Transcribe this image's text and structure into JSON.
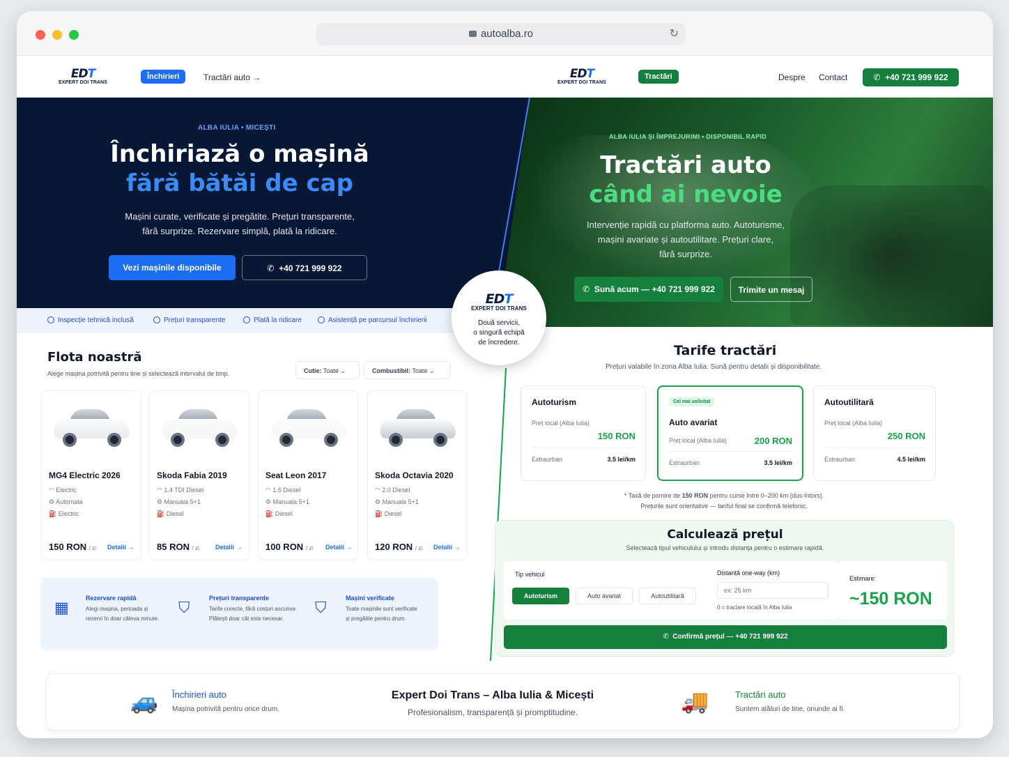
{
  "browser": {
    "url": "autoalba.ro"
  },
  "nav": {
    "logo_mark": "EDT",
    "logo_text": "EXPERT DOI TRANS",
    "rent_pill": "Închirieri",
    "tow_link": "Tractări auto",
    "tow_pill": "Tractări",
    "about": "Despre",
    "contact": "Contact",
    "phone": "+40 721 999 922"
  },
  "hero_left": {
    "kicker": "ALBA IULIA • MICEȘTI",
    "title_line1": "Închiriază o mașină",
    "title_line2": "fără bătăi de cap",
    "lead_line1": "Mașini curate, verificate și pregătite. Prețuri transparente,",
    "lead_line2": "fără surprize. Rezervare simplă, plată la ridicare.",
    "btn_primary": "Vezi mașinile disponibile",
    "btn_phone": "+40 721 999 922"
  },
  "hero_right": {
    "kicker": "ALBA IULIA ȘI ÎMPREJURIMI • DISPONIBIL RAPID",
    "title_line1": "Tractări auto",
    "title_line2": "când ai nevoie",
    "lead_line1": "Intervenție rapidă cu platforma auto. Autoturisme,",
    "lead_line2": "mașini avariate și autoutilitare. Prețuri clare,",
    "lead_line3": "fără surprize.",
    "btn_call": "Sună acum — +40 721 999 922",
    "btn_msg": "Trimite un mesaj"
  },
  "features": [
    "Inspecție tehnică inclusă",
    "Prețuri transparente",
    "Plată la ridicare",
    "Asistență pe parcursul închirierii"
  ],
  "badge": {
    "logo_mark": "EDT",
    "logo_text": "EXPERT DOI TRANS",
    "line1": "Două servicii,",
    "line2": "o singură echipă",
    "line3": "de încredere."
  },
  "fleet": {
    "title": "Flota noastră",
    "subtitle": "Alege mașina potrivită pentru tine și selectează intervalul de timp.",
    "filter_gear_label": "Cutie:",
    "filter_gear_value": "Toate",
    "filter_fuel_label": "Combustibil:",
    "filter_fuel_value": "Toate",
    "per_day": "/ zi",
    "details": "Detalii",
    "cars": [
      {
        "name": "MG4 Electric 2026",
        "engine": "Electric",
        "gearbox": "Automata",
        "fuel": "Electric",
        "price": "150 RON",
        "color": "#e8eaee"
      },
      {
        "name": "Skoda Fabia 2019",
        "engine": "1.4 TDI Diesel",
        "gearbox": "Manuala 5+1",
        "fuel": "Diesel",
        "price": "85 RON",
        "color": "#f5f5f5"
      },
      {
        "name": "Seat Leon 2017",
        "engine": "1.6 Diesel",
        "gearbox": "Manuala 5+1",
        "fuel": "Diesel",
        "price": "100 RON",
        "color": "#f8f8f8"
      },
      {
        "name": "Skoda Octavia 2020",
        "engine": "2.0 Diesel",
        "gearbox": "Manuala 5+1",
        "fuel": "Diesel",
        "price": "120 RON",
        "color": "#c8ccd2"
      }
    ]
  },
  "info": [
    {
      "title": "Rezervare rapidă",
      "d1": "Alegi mașina, perioada și",
      "d2": "rezervi în doar câteva minute."
    },
    {
      "title": "Prețuri transparente",
      "d1": "Tarife corecte, fără costuri ascunse.",
      "d2": "Plătești doar cât este necesar."
    },
    {
      "title": "Mașini verificate",
      "d1": "Toate mașinile sunt verificate",
      "d2": "și pregătite pentru drum."
    }
  ],
  "tariffs": {
    "title": "Tarife tractări",
    "subtitle": "Prețuri valabile în zona Alba Iulia. Sună pentru detalii și disponibilitate.",
    "local_label": "Preț local (Alba Iulia)",
    "extra_label": "Extraurban",
    "popular": "Cel mai solicitat",
    "cards": [
      {
        "name": "Autoturism",
        "price": "150 RON",
        "extra": "3.5 lei/km"
      },
      {
        "name": "Auto avariat",
        "price": "200 RON",
        "extra": "3.5 lei/km"
      },
      {
        "name": "Autoutilitară",
        "price": "250 RON",
        "extra": "4.5 lei/km"
      }
    ],
    "note1_pre": "* Taxă de pornire de ",
    "note1_bold": "150 RON",
    "note1_post": " pentru curse între 0–200 km (dus-întors).",
    "note2": "Prețurile sunt orientative — tariful final se confirmă telefonic."
  },
  "calc": {
    "title": "Calculează prețul",
    "subtitle": "Selectează tipul vehiculului și introdu distanța pentru o estimare rapidă.",
    "type_label": "Tip vehicul",
    "types": [
      "Autoturism",
      "Auto avariat",
      "Autoutilitară"
    ],
    "dist_label": "Distanță one-way (km)",
    "dist_placeholder": "ex: 25 km",
    "dist_hint": "0 = tractare locală în Alba Iulia",
    "est_label": "Estimare:",
    "est_value": "~150 RON",
    "confirm": "Confirmă prețul — +40 721 999 922"
  },
  "footer": {
    "rent_title": "Închirieri auto",
    "rent_desc": "Mașina potrivită pentru orice drum.",
    "brand_title": "Expert Doi Trans – Alba Iulia & Micești",
    "brand_desc": "Profesionalism, transparență și promptitudine.",
    "tow_title": "Tractări auto",
    "tow_desc": "Suntem alături de tine, oriunde ai fi."
  },
  "colors": {
    "navy": "#081736",
    "blue": "#1d6df2",
    "green": "#15803d",
    "green_light": "#4ade80"
  }
}
